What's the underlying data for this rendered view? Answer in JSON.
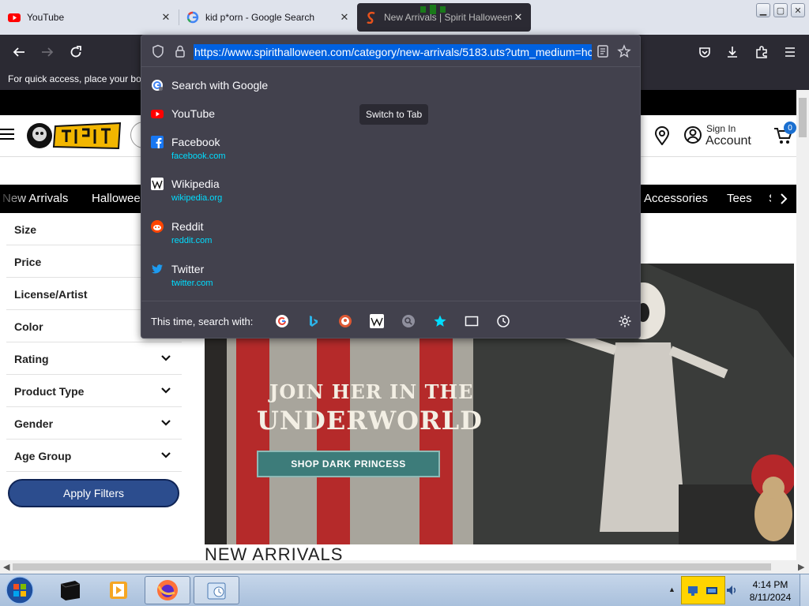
{
  "browser": {
    "tabs": [
      {
        "title": "YouTube",
        "favicon": "youtube-icon"
      },
      {
        "title": "kid p*orn - Google Search",
        "favicon": "google-icon"
      },
      {
        "title": "New Arrivals | Spirit Halloween",
        "favicon": "spirit-icon",
        "active": true
      }
    ],
    "close_glyph": "✕",
    "window_controls": {
      "minimize": "▁",
      "maximize": "▢",
      "close": "✕"
    },
    "bookmarks_hint": "For quick access, place your boo"
  },
  "urlbar": {
    "url": "https://www.spirithalloween.com/category/new-arrivals/5183.uts?utm_medium=hc",
    "suggestions": [
      {
        "name": "Search with Google",
        "link": "",
        "icon": "google-icon"
      },
      {
        "name": "YouTube",
        "link": "",
        "icon": "youtube-icon",
        "action": "Switch to Tab"
      },
      {
        "name": "Facebook",
        "link": "facebook.com",
        "icon": "facebook-icon"
      },
      {
        "name": "Wikipedia",
        "link": "wikipedia.org",
        "icon": "wikipedia-icon"
      },
      {
        "name": "Reddit",
        "link": "reddit.com",
        "icon": "reddit-icon"
      },
      {
        "name": "Twitter",
        "link": "twitter.com",
        "icon": "twitter-icon"
      }
    ],
    "search_with_label": "This time, search with:",
    "engines": [
      "google-icon",
      "bing-icon",
      "duckduckgo-icon",
      "wikipedia-icon",
      "search-icon",
      "bookmarks-star-icon",
      "tabs-icon",
      "history-icon"
    ]
  },
  "site": {
    "account": {
      "sign_in": "Sign In",
      "label": "Account"
    },
    "cart_count": "0",
    "nav": [
      "New Arrivals",
      "Hallowee",
      "Accessories",
      "Tees",
      "S"
    ],
    "filters": [
      "Size",
      "Price",
      "License/Artist",
      "Color",
      "Rating",
      "Product Type",
      "Gender",
      "Age Group"
    ],
    "apply_label": "Apply Filters",
    "banner": {
      "line1": "JOIN HER IN THE",
      "line2": "UNDERWORLD",
      "cta": "SHOP DARK PRINCESS"
    },
    "section_title": "NEW ARRIVALS"
  },
  "taskbar": {
    "time": "4:14 PM",
    "date": "8/11/2024",
    "tray_toggle": "▲"
  },
  "colors": {
    "accent": "#0061e0",
    "link": "#00ddff",
    "dropdown_bg": "#42414d",
    "toolbar_bg": "#2b2a33",
    "apply_button": "#2c4d8e"
  }
}
